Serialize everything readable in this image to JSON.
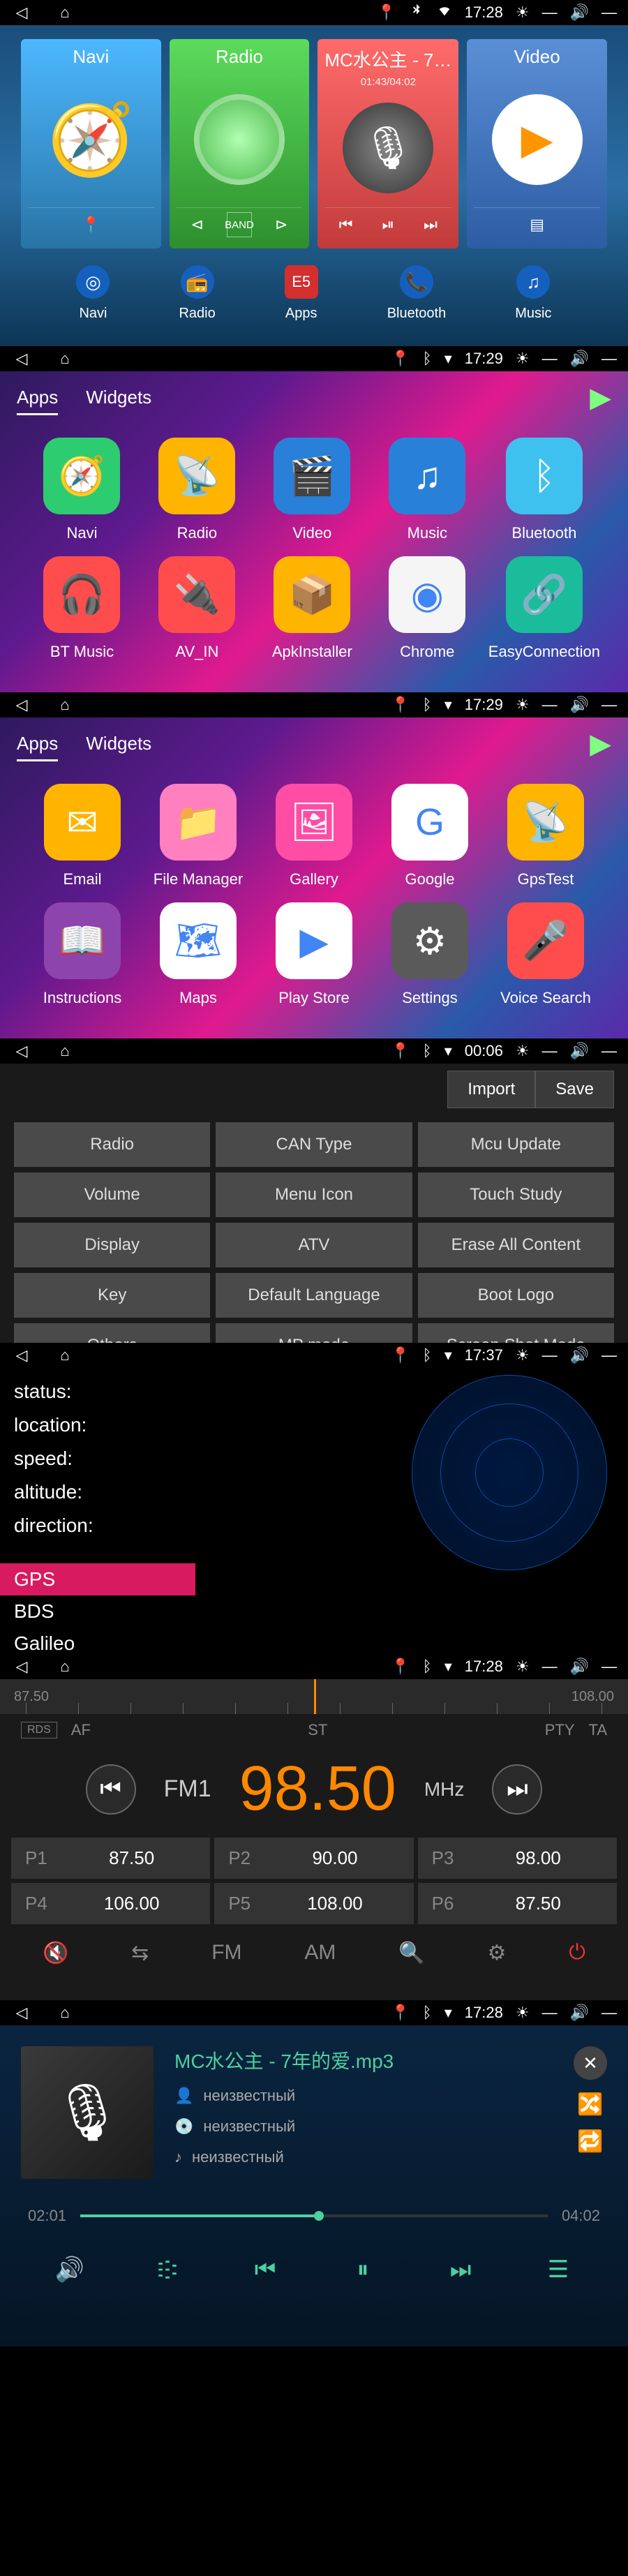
{
  "status_times": [
    "17:28",
    "17:29",
    "17:29",
    "00:06",
    "17:37",
    "17:28",
    "17:28"
  ],
  "home": {
    "cards": {
      "navi": {
        "title": "Navi"
      },
      "radio": {
        "title": "Radio",
        "band": "BAND"
      },
      "music": {
        "title": "MC水公主 - 7…",
        "time": "01:43/04:02"
      },
      "video": {
        "title": "Video"
      }
    },
    "dock": [
      {
        "label": "Navi"
      },
      {
        "label": "Radio"
      },
      {
        "label": "Apps",
        "badge": "E5"
      },
      {
        "label": "Bluetooth"
      },
      {
        "label": "Music"
      }
    ]
  },
  "drawer": {
    "tabs": {
      "apps": "Apps",
      "widgets": "Widgets"
    },
    "page1": [
      {
        "label": "Navi",
        "color": "#2ecc71"
      },
      {
        "label": "Radio",
        "color": "#ffb400"
      },
      {
        "label": "Video",
        "color": "#2980d9"
      },
      {
        "label": "Music",
        "color": "#2980d9"
      },
      {
        "label": "Bluetooth",
        "color": "#3fc1f0"
      },
      {
        "label": "BT Music",
        "color": "#ff4d4d"
      },
      {
        "label": "AV_IN",
        "color": "#ff4d4d"
      },
      {
        "label": "ApkInstaller",
        "color": "#ffb400"
      },
      {
        "label": "Chrome",
        "color": "#f5f5f5"
      },
      {
        "label": "EasyConnection",
        "color": "#1abc9c"
      }
    ],
    "page2": [
      {
        "label": "Email",
        "color": "#ffb400"
      },
      {
        "label": "File Manager",
        "color": "#ff7fbf"
      },
      {
        "label": "Gallery",
        "color": "#ff4da6"
      },
      {
        "label": "Google",
        "color": "#ffffff"
      },
      {
        "label": "GpsTest",
        "color": "#ffb400"
      },
      {
        "label": "Instructions",
        "color": "#8e44ad"
      },
      {
        "label": "Maps",
        "color": "#ffffff"
      },
      {
        "label": "Play Store",
        "color": "#ffffff"
      },
      {
        "label": "Settings",
        "color": "#5a5a5a"
      },
      {
        "label": "Voice Search",
        "color": "#ff4d4d"
      }
    ]
  },
  "settings": {
    "import": "Import",
    "save": "Save",
    "buttons": [
      "Radio",
      "CAN Type",
      "Mcu Update",
      "Volume",
      "Menu Icon",
      "Touch Study",
      "Display",
      "ATV",
      "Erase All Content",
      "Key",
      "Default Language",
      "Boot Logo",
      "Others",
      "MP mode",
      "Screen Shot Mode"
    ]
  },
  "gps": {
    "labels": {
      "status": "status:",
      "location": "location:",
      "speed": "speed:",
      "altitude": "altitude:",
      "direction": "direction:"
    },
    "systems": [
      "GPS",
      "BDS",
      "Galileo"
    ]
  },
  "radio": {
    "range_min": "87.50",
    "range_max": "108.00",
    "tags": [
      "AF",
      "ST",
      "PTY",
      "TA"
    ],
    "rds": "RDS",
    "band": "FM1",
    "freq": "98.50",
    "unit": "MHz",
    "presets": [
      {
        "n": "P1",
        "v": "87.50"
      },
      {
        "n": "P2",
        "v": "90.00"
      },
      {
        "n": "P3",
        "v": "98.00"
      },
      {
        "n": "P4",
        "v": "106.00"
      },
      {
        "n": "P5",
        "v": "108.00"
      },
      {
        "n": "P6",
        "v": "87.50"
      }
    ],
    "controls": {
      "fm": "FM",
      "am": "AM"
    }
  },
  "player": {
    "title": "MC水公主 - 7年的爱.mp3",
    "artist": "неизвестный",
    "album": "неизвестный",
    "genre": "неизвестный",
    "elapsed": "02:01",
    "total": "04:02"
  }
}
